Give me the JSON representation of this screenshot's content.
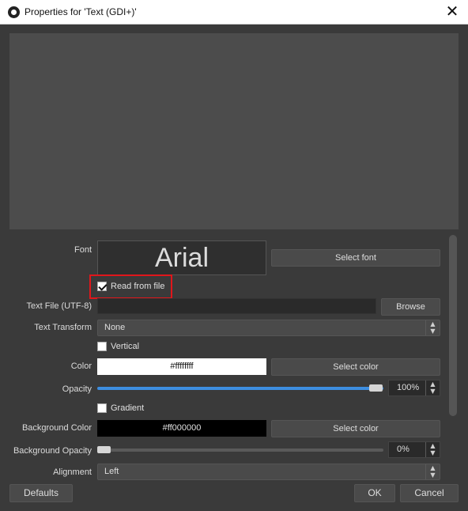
{
  "window": {
    "title": "Properties for 'Text (GDI+)'",
    "close_glyph": "✕"
  },
  "font": {
    "label": "Font",
    "preview": "Arial",
    "select_button": "Select font"
  },
  "read_from_file": {
    "label": "Read from file",
    "checked": true
  },
  "text_file": {
    "label": "Text File (UTF-8)",
    "value": "",
    "browse_button": "Browse"
  },
  "text_transform": {
    "label": "Text Transform",
    "value": "None"
  },
  "vertical": {
    "label": "Vertical",
    "checked": false
  },
  "color": {
    "label": "Color",
    "value": "#ffffffff",
    "swatch_color": "#ffffff",
    "select_button": "Select color"
  },
  "opacity": {
    "label": "Opacity",
    "value": "100%",
    "fraction": 1.0
  },
  "gradient": {
    "label": "Gradient",
    "checked": false
  },
  "background_color": {
    "label": "Background Color",
    "value": "#ff000000",
    "swatch_color": "#000000",
    "select_button": "Select color"
  },
  "background_opacity": {
    "label": "Background Opacity",
    "value": "0%",
    "fraction": 0.0
  },
  "alignment": {
    "label": "Alignment",
    "value": "Left"
  },
  "footer": {
    "defaults_button": "Defaults",
    "ok_button": "OK",
    "cancel_button": "Cancel"
  },
  "icons": {
    "app": "obs-logo-icon",
    "close": "close-icon",
    "combo_arrows": "up-down-chevron-icon"
  },
  "colors": {
    "accent": "#3d8ee0",
    "highlight_border": "#e0161b"
  }
}
